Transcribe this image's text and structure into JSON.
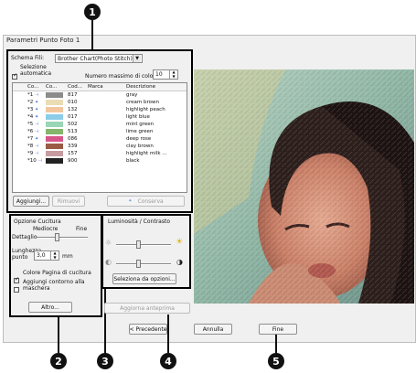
{
  "window": {
    "title": "Parametri Punto Foto 1"
  },
  "callouts": [
    "1",
    "2",
    "3",
    "4",
    "5"
  ],
  "thread_panel": {
    "chart_label": "Schema Fili:",
    "chart_value": "Brother Chart(Photo Stitch)",
    "auto_select_label": "Selezione automatica",
    "max_colors_label": "Numero massimo di colori:",
    "max_colors_value": "10",
    "columns": [
      "Co...",
      "Co...",
      "Cod...",
      "Marca",
      "Descrizione"
    ],
    "rows": [
      {
        "idx": "*1",
        "code": "817",
        "brand": "",
        "desc": "gray",
        "color": "#8b8b8b",
        "pinned": false
      },
      {
        "idx": "*2",
        "code": "010",
        "brand": "",
        "desc": "cream brown",
        "color": "#eadcb4",
        "pinned": true
      },
      {
        "idx": "*3",
        "code": "132",
        "brand": "",
        "desc": "highlight peach",
        "color": "#f2c79f",
        "pinned": true
      },
      {
        "idx": "*4",
        "code": "017",
        "brand": "",
        "desc": "light blue",
        "color": "#8ccde8",
        "pinned": true
      },
      {
        "idx": "*5",
        "code": "502",
        "brand": "",
        "desc": "mint green",
        "color": "#9ad6b6",
        "pinned": false
      },
      {
        "idx": "*6",
        "code": "513",
        "brand": "",
        "desc": "lime green",
        "color": "#86b56c",
        "pinned": false
      },
      {
        "idx": "*7",
        "code": "086",
        "brand": "",
        "desc": "deep rose",
        "color": "#d7568a",
        "pinned": true
      },
      {
        "idx": "*8",
        "code": "339",
        "brand": "",
        "desc": "clay brown",
        "color": "#9a5a45",
        "pinned": false
      },
      {
        "idx": "*9",
        "code": "157",
        "brand": "",
        "desc": "highlight milk ...",
        "color": "#c69ca0",
        "pinned": false
      },
      {
        "idx": "*10",
        "code": "900",
        "brand": "",
        "desc": "black",
        "color": "#222222",
        "pinned": false
      }
    ],
    "add_button": "Aggiungi...",
    "remove_button": "Rimuovi",
    "keep_button": "Conserva"
  },
  "sewing": {
    "group_label": "Opzione Cucitura",
    "mediocre_label": "Mediocre",
    "fine_label": "Fine",
    "detail_label": "Dettaglio",
    "length_label": "Lunghezza punto",
    "length_value": "3,0",
    "length_unit": "mm",
    "page_color_label": "Colore Pagina di cucitura",
    "outline_label": "Aggiungi contorno alla maschera",
    "other_button": "Altro..."
  },
  "brightness": {
    "group_label": "Luminosità / Contrasto",
    "select_button": "Seleziona da opzioni..."
  },
  "preview": {
    "update_button": "Aggiorna anteprima"
  },
  "footer": {
    "prev_button": "< Precedente",
    "cancel_button": "Annulla",
    "finish_button": "Fine"
  }
}
